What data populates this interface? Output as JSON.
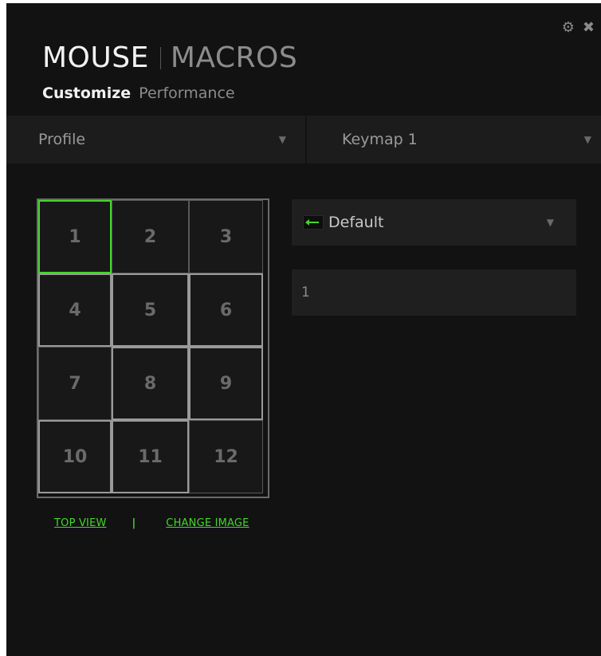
{
  "window_controls": {
    "settings_icon": "gear-icon",
    "close_icon": "close-icon"
  },
  "header": {
    "primary_tab": "MOUSE",
    "secondary_tab": "MACROS"
  },
  "subtabs": {
    "active": "Customize",
    "inactive": "Performance"
  },
  "profile_dropdown": {
    "label": "Profile"
  },
  "keymap_dropdown": {
    "label": "Keymap 1"
  },
  "button_grid": {
    "buttons": [
      "1",
      "2",
      "3",
      "4",
      "5",
      "6",
      "7",
      "8",
      "9",
      "10",
      "11",
      "12"
    ],
    "selected": "1"
  },
  "view_links": {
    "top_view": "TOP VIEW",
    "separator": "|",
    "change_image": "CHANGE IMAGE"
  },
  "assignment": {
    "function_label": "Default",
    "key_value": "1"
  },
  "colors": {
    "accent": "#44d62c",
    "background": "#121212"
  }
}
